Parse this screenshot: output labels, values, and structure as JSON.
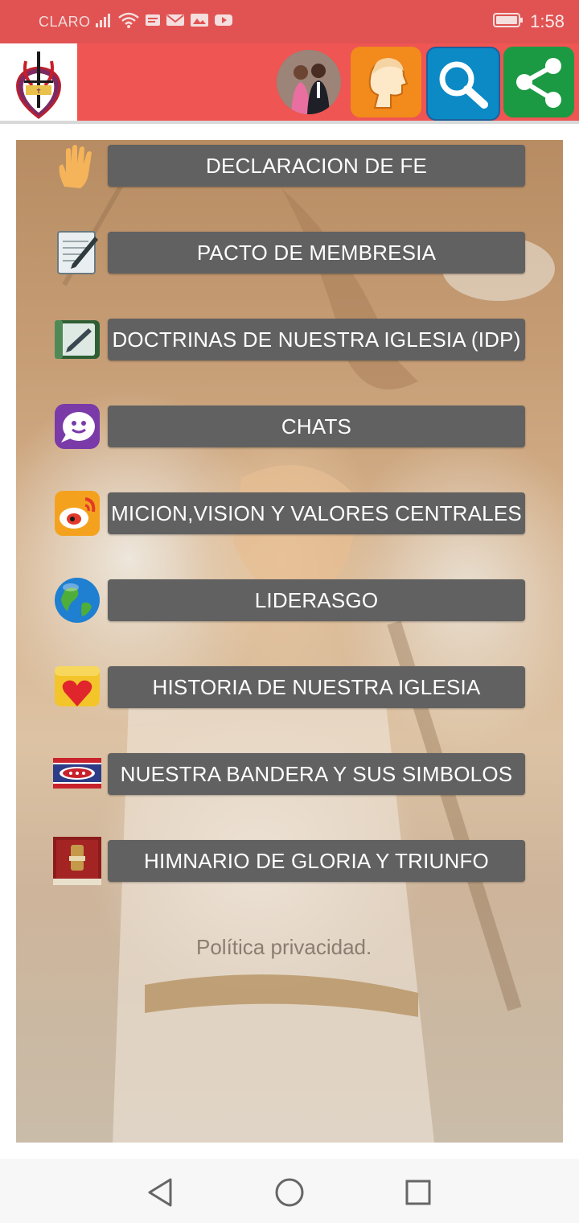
{
  "status_bar": {
    "carrier": "CLARO",
    "time": "1:58",
    "icons": [
      "signal-icon",
      "wifi-icon",
      "message-icon",
      "mail-icon",
      "gallery-icon",
      "youtube-icon",
      "battery-icon"
    ]
  },
  "header": {
    "colors": {
      "bar": "#ef5553",
      "status": "#e05352"
    },
    "buttons": [
      "church-logo",
      "pastors-avatar",
      "head-profile-icon",
      "search-icon",
      "share-icon"
    ]
  },
  "menu": {
    "items": [
      {
        "label": "DECLARACION DE FE",
        "icon": "hand-icon"
      },
      {
        "label": "PACTO DE MEMBRESIA",
        "icon": "document-pen-icon"
      },
      {
        "label": "DOCTRINAS DE NUESTRA IGLESIA (IDP)",
        "icon": "notebook-icon"
      },
      {
        "label": "CHATS",
        "icon": "chat-icon"
      },
      {
        "label": "MICION,VISION Y VALORES CENTRALES",
        "icon": "weibo-icon"
      },
      {
        "label": "LIDERASGO",
        "icon": "globe-icon"
      },
      {
        "label": "HISTORIA DE NUESTRA IGLESIA",
        "icon": "heart-icon"
      },
      {
        "label": "NUESTRA BANDERA Y SUS SIMBOLOS",
        "icon": "flag-icon"
      },
      {
        "label": "HIMNARIO DE GLORIA Y TRIUNFO",
        "icon": "hymnal-icon"
      }
    ],
    "button_color": "#616161"
  },
  "privacy_link": "Política privacidad.",
  "nav_bar": {
    "buttons": [
      "back-icon",
      "home-icon",
      "recents-icon"
    ]
  }
}
